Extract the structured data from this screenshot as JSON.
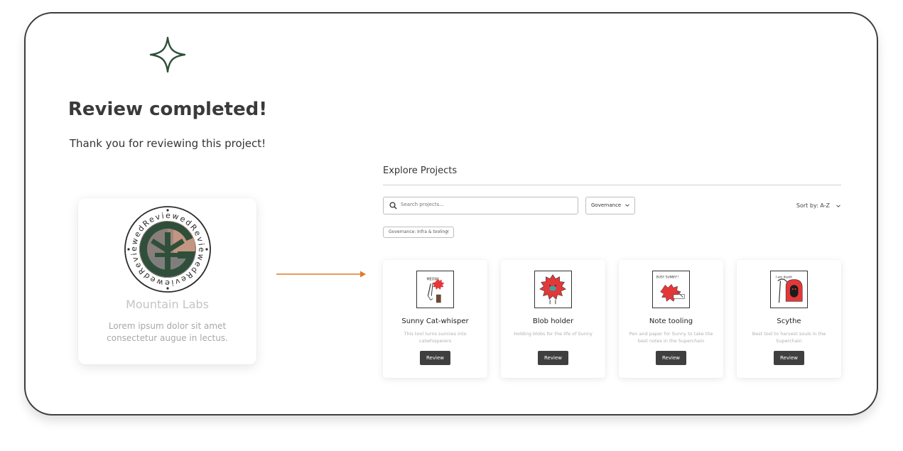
{
  "completion": {
    "title": "Review completed!",
    "subtitle": "Thank you for reviewing this project!",
    "icon": "sparkle-icon"
  },
  "reviewed_project": {
    "name": "Mountain Labs",
    "description": "Lorem ipsum dolor sit amet consectetur augue in lectus.",
    "badge_text": "Reviewed",
    "badge_icon": "reviewed-badge-icon",
    "accent_color": "#2f4f3a"
  },
  "explore": {
    "title": "Explore Projects",
    "search": {
      "placeholder": "Search projects..."
    },
    "filter": {
      "value": "Governance"
    },
    "sort": {
      "label": "Sort by: A-Z"
    },
    "active_filter": {
      "label": "Governance: Infra & tooling"
    },
    "projects": [
      {
        "name": "Sunny Cat-whisper",
        "description": "This tool turns sunnies into catwhisperers",
        "action": "Review",
        "thumb_text": "MEOW!"
      },
      {
        "name": "Blob holder",
        "description": "Holding blobs for the life of Sunny",
        "action": "Review"
      },
      {
        "name": "Note tooling",
        "description": "Pen and paper for Sunny to take the best notes in the Superchain",
        "action": "Review",
        "thumb_text": "BUSY SUNNY!!"
      },
      {
        "name": "Scythe",
        "description": "Best tool to harvest souls in the Superchain",
        "action": "Review",
        "thumb_text": "I am death"
      }
    ]
  },
  "colors": {
    "arrow": "#e07a2e",
    "mascot_red": "#e2383a",
    "button_bg": "#3f3f3f"
  }
}
